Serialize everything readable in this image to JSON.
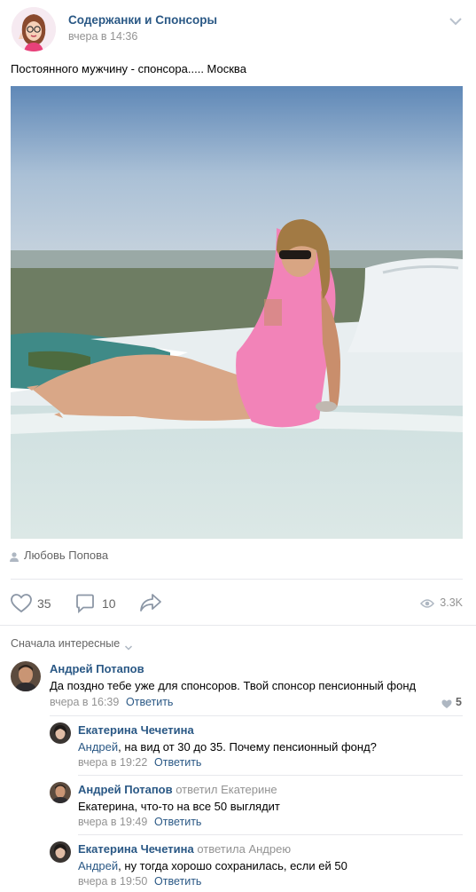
{
  "post": {
    "group_name": "Содержанки и Спонсоры",
    "time": "вчера в 14:36",
    "text": "Постоянного мужчину - спонсора..... Москва",
    "photo_author": "Любовь Попова",
    "likes": "35",
    "comments": "10",
    "views": "3.3K"
  },
  "comments": {
    "sort_label": "Сначала интересные",
    "items": [
      {
        "author": "Андрей Потапов",
        "reply_to": "",
        "addressee": "",
        "text": "Да поздно тебе уже для спонсоров. Твой спонсор пенсионный фонд",
        "time": "вчера в 16:39",
        "reply_label": "Ответить",
        "likes": "5"
      },
      {
        "author": "Екатерина Чечетина",
        "reply_to": "",
        "addressee": "Андрей",
        "text": ", на вид от 30 до 35. Почему пенсионный фонд?",
        "time": "вчера в 19:22",
        "reply_label": "Ответить"
      },
      {
        "author": "Андрей Потапов",
        "reply_to": "ответил Екатерине",
        "addressee": "",
        "text": "Екатерина, что-то на все 50 выглядит",
        "time": "вчера в 19:49",
        "reply_label": "Ответить"
      },
      {
        "author": "Екатерина Чечетина",
        "reply_to": "ответила Андрею",
        "addressee": "Андрей",
        "text": ", ну тогда хорошо сохранилась, если ей 50",
        "time": "вчера в 19:50",
        "reply_label": "Ответить"
      }
    ]
  },
  "colors": {
    "link": "#2a5885",
    "muted": "#939393",
    "like_active": "#ff3347"
  }
}
